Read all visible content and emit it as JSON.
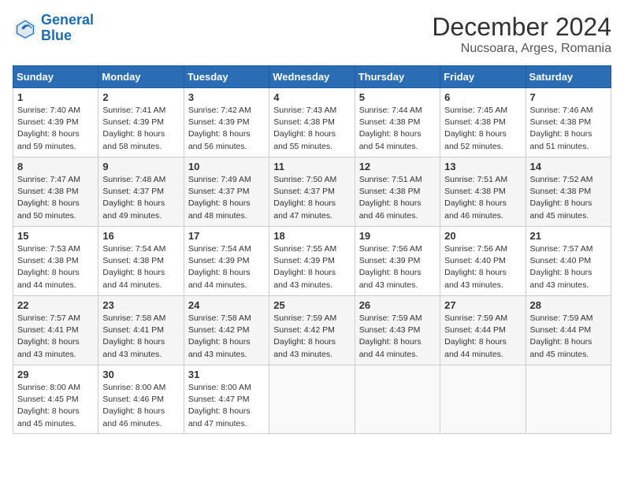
{
  "header": {
    "logo_line1": "General",
    "logo_line2": "Blue",
    "month": "December 2024",
    "location": "Nucsoara, Arges, Romania"
  },
  "days_of_week": [
    "Sunday",
    "Monday",
    "Tuesday",
    "Wednesday",
    "Thursday",
    "Friday",
    "Saturday"
  ],
  "weeks": [
    [
      {
        "day": "1",
        "sunrise": "Sunrise: 7:40 AM",
        "sunset": "Sunset: 4:39 PM",
        "daylight": "Daylight: 8 hours and 59 minutes."
      },
      {
        "day": "2",
        "sunrise": "Sunrise: 7:41 AM",
        "sunset": "Sunset: 4:39 PM",
        "daylight": "Daylight: 8 hours and 58 minutes."
      },
      {
        "day": "3",
        "sunrise": "Sunrise: 7:42 AM",
        "sunset": "Sunset: 4:39 PM",
        "daylight": "Daylight: 8 hours and 56 minutes."
      },
      {
        "day": "4",
        "sunrise": "Sunrise: 7:43 AM",
        "sunset": "Sunset: 4:38 PM",
        "daylight": "Daylight: 8 hours and 55 minutes."
      },
      {
        "day": "5",
        "sunrise": "Sunrise: 7:44 AM",
        "sunset": "Sunset: 4:38 PM",
        "daylight": "Daylight: 8 hours and 54 minutes."
      },
      {
        "day": "6",
        "sunrise": "Sunrise: 7:45 AM",
        "sunset": "Sunset: 4:38 PM",
        "daylight": "Daylight: 8 hours and 52 minutes."
      },
      {
        "day": "7",
        "sunrise": "Sunrise: 7:46 AM",
        "sunset": "Sunset: 4:38 PM",
        "daylight": "Daylight: 8 hours and 51 minutes."
      }
    ],
    [
      {
        "day": "8",
        "sunrise": "Sunrise: 7:47 AM",
        "sunset": "Sunset: 4:38 PM",
        "daylight": "Daylight: 8 hours and 50 minutes."
      },
      {
        "day": "9",
        "sunrise": "Sunrise: 7:48 AM",
        "sunset": "Sunset: 4:37 PM",
        "daylight": "Daylight: 8 hours and 49 minutes."
      },
      {
        "day": "10",
        "sunrise": "Sunrise: 7:49 AM",
        "sunset": "Sunset: 4:37 PM",
        "daylight": "Daylight: 8 hours and 48 minutes."
      },
      {
        "day": "11",
        "sunrise": "Sunrise: 7:50 AM",
        "sunset": "Sunset: 4:37 PM",
        "daylight": "Daylight: 8 hours and 47 minutes."
      },
      {
        "day": "12",
        "sunrise": "Sunrise: 7:51 AM",
        "sunset": "Sunset: 4:38 PM",
        "daylight": "Daylight: 8 hours and 46 minutes."
      },
      {
        "day": "13",
        "sunrise": "Sunrise: 7:51 AM",
        "sunset": "Sunset: 4:38 PM",
        "daylight": "Daylight: 8 hours and 46 minutes."
      },
      {
        "day": "14",
        "sunrise": "Sunrise: 7:52 AM",
        "sunset": "Sunset: 4:38 PM",
        "daylight": "Daylight: 8 hours and 45 minutes."
      }
    ],
    [
      {
        "day": "15",
        "sunrise": "Sunrise: 7:53 AM",
        "sunset": "Sunset: 4:38 PM",
        "daylight": "Daylight: 8 hours and 44 minutes."
      },
      {
        "day": "16",
        "sunrise": "Sunrise: 7:54 AM",
        "sunset": "Sunset: 4:38 PM",
        "daylight": "Daylight: 8 hours and 44 minutes."
      },
      {
        "day": "17",
        "sunrise": "Sunrise: 7:54 AM",
        "sunset": "Sunset: 4:39 PM",
        "daylight": "Daylight: 8 hours and 44 minutes."
      },
      {
        "day": "18",
        "sunrise": "Sunrise: 7:55 AM",
        "sunset": "Sunset: 4:39 PM",
        "daylight": "Daylight: 8 hours and 43 minutes."
      },
      {
        "day": "19",
        "sunrise": "Sunrise: 7:56 AM",
        "sunset": "Sunset: 4:39 PM",
        "daylight": "Daylight: 8 hours and 43 minutes."
      },
      {
        "day": "20",
        "sunrise": "Sunrise: 7:56 AM",
        "sunset": "Sunset: 4:40 PM",
        "daylight": "Daylight: 8 hours and 43 minutes."
      },
      {
        "day": "21",
        "sunrise": "Sunrise: 7:57 AM",
        "sunset": "Sunset: 4:40 PM",
        "daylight": "Daylight: 8 hours and 43 minutes."
      }
    ],
    [
      {
        "day": "22",
        "sunrise": "Sunrise: 7:57 AM",
        "sunset": "Sunset: 4:41 PM",
        "daylight": "Daylight: 8 hours and 43 minutes."
      },
      {
        "day": "23",
        "sunrise": "Sunrise: 7:58 AM",
        "sunset": "Sunset: 4:41 PM",
        "daylight": "Daylight: 8 hours and 43 minutes."
      },
      {
        "day": "24",
        "sunrise": "Sunrise: 7:58 AM",
        "sunset": "Sunset: 4:42 PM",
        "daylight": "Daylight: 8 hours and 43 minutes."
      },
      {
        "day": "25",
        "sunrise": "Sunrise: 7:59 AM",
        "sunset": "Sunset: 4:42 PM",
        "daylight": "Daylight: 8 hours and 43 minutes."
      },
      {
        "day": "26",
        "sunrise": "Sunrise: 7:59 AM",
        "sunset": "Sunset: 4:43 PM",
        "daylight": "Daylight: 8 hours and 44 minutes."
      },
      {
        "day": "27",
        "sunrise": "Sunrise: 7:59 AM",
        "sunset": "Sunset: 4:44 PM",
        "daylight": "Daylight: 8 hours and 44 minutes."
      },
      {
        "day": "28",
        "sunrise": "Sunrise: 7:59 AM",
        "sunset": "Sunset: 4:44 PM",
        "daylight": "Daylight: 8 hours and 45 minutes."
      }
    ],
    [
      {
        "day": "29",
        "sunrise": "Sunrise: 8:00 AM",
        "sunset": "Sunset: 4:45 PM",
        "daylight": "Daylight: 8 hours and 45 minutes."
      },
      {
        "day": "30",
        "sunrise": "Sunrise: 8:00 AM",
        "sunset": "Sunset: 4:46 PM",
        "daylight": "Daylight: 8 hours and 46 minutes."
      },
      {
        "day": "31",
        "sunrise": "Sunrise: 8:00 AM",
        "sunset": "Sunset: 4:47 PM",
        "daylight": "Daylight: 8 hours and 47 minutes."
      },
      null,
      null,
      null,
      null
    ]
  ]
}
